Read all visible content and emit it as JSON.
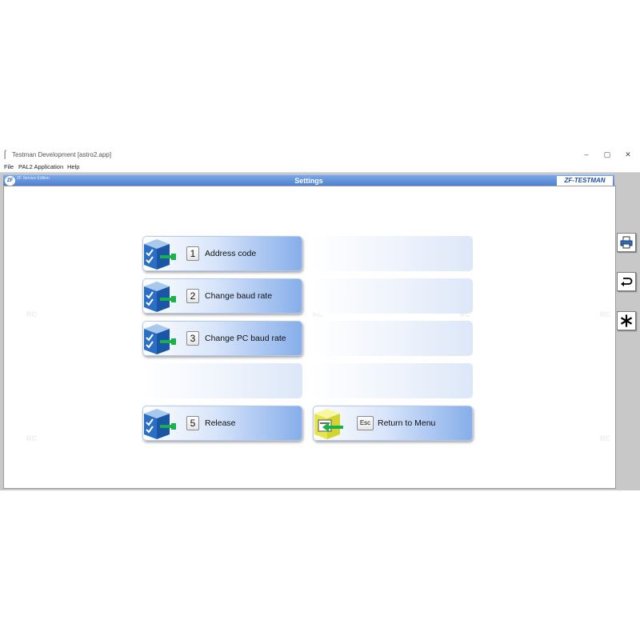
{
  "window": {
    "title": "Testman Development [astro2.app]",
    "controls": {
      "minimize": "–",
      "maximize": "▢",
      "close": "✕"
    }
  },
  "menubar": {
    "items": [
      "File",
      "PAL2 Application",
      "Help"
    ]
  },
  "header": {
    "logo_text": "ZF",
    "edition": "ZF Service Edition",
    "title": "Settings",
    "brand": "ZF-TESTMAN"
  },
  "watermark": "RC",
  "tiles": [
    {
      "key": "1",
      "label": "Address code",
      "icon": "checklist-cube-icon"
    },
    {
      "key": "2",
      "label": "Change baud rate",
      "icon": "checklist-cube-icon"
    },
    {
      "key": "3",
      "label": "Change PC baud rate",
      "icon": "checklist-cube-icon"
    },
    {
      "key": "5",
      "label": "Release",
      "icon": "checklist-cube-icon"
    },
    {
      "key": "Esc",
      "label": "Return to Menu",
      "icon": "return-arrow-cube-icon"
    }
  ],
  "side_buttons": [
    "print-icon",
    "back-icon",
    "asterisk-icon"
  ],
  "colors": {
    "header": "#4a7fd0",
    "tile_accent": "#86aeea",
    "icon_blue": "#2a6fc4",
    "icon_green": "#19b24a",
    "return_yellow": "#f0f060"
  }
}
